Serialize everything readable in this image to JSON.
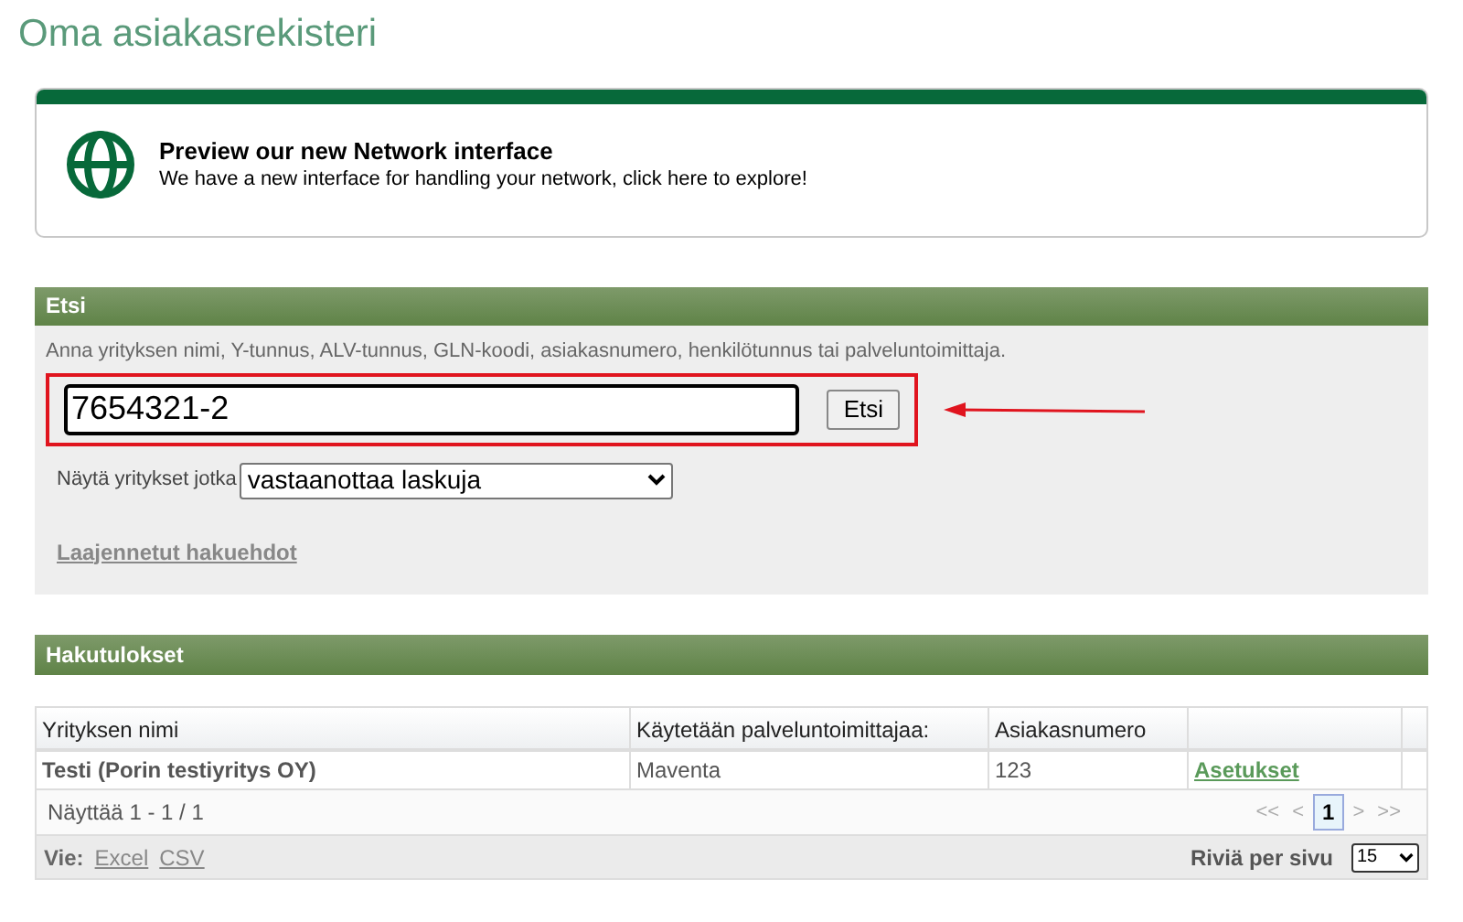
{
  "page_title": "Oma asiakasrekisteri",
  "banner": {
    "title": "Preview our new Network interface",
    "text": "We have a new interface for handling your network, click here to explore!"
  },
  "search": {
    "header": "Etsi",
    "hint": "Anna yrityksen nimi, Y-tunnus, ALV-tunnus, GLN-koodi, asiakasnumero, henkilötunnus tai palveluntoimittaja.",
    "value": "7654321-2",
    "button": "Etsi",
    "filter_label": "Näytä yritykset jotka",
    "filter_value": "vastaanottaa laskuja",
    "advanced_link": "Laajennetut hakuehdot"
  },
  "results": {
    "header": "Hakutulokset",
    "columns": [
      "Yrityksen nimi",
      "Käytetään palveluntoimittajaa:",
      "Asiakasnumero"
    ],
    "rows": [
      {
        "name": "Testi (Porin testiyritys OY)",
        "provider": "Maventa",
        "number": "123",
        "action": "Asetukset"
      }
    ],
    "showing": "Näyttää 1 - 1 / 1",
    "pager": [
      {
        "label": "<<",
        "kind": "nav"
      },
      {
        "label": "<",
        "kind": "nav"
      },
      {
        "label": "1",
        "kind": "page",
        "selected": true
      },
      {
        "label": ">",
        "kind": "nav"
      },
      {
        "label": ">>",
        "kind": "nav"
      }
    ],
    "export_label": "Vie:",
    "exports": [
      "Excel",
      "CSV"
    ],
    "rows_per_page_label": "Riviä per sivu",
    "rows_per_page": "15"
  }
}
